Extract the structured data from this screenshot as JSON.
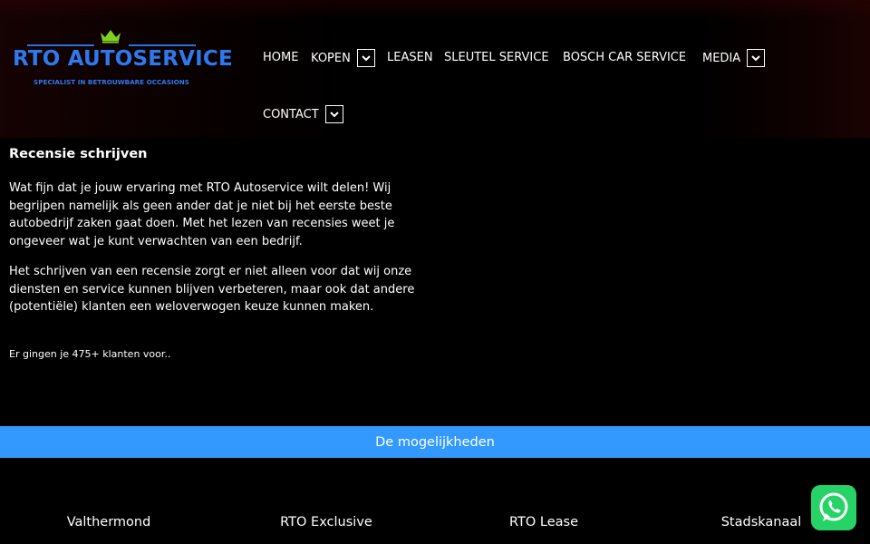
{
  "brand": {
    "name": "RTO AUTOSERVICE",
    "tagline": "SPECIALIST IN BETROUWBARE OCCASIONS",
    "color": "#2f78ee",
    "crown_color": "#7ed321",
    "icon": "crown-icon"
  },
  "nav": {
    "home": "HOME",
    "kopen": "KOPEN",
    "leasen": "LEASEN",
    "sleutel": "SLEUTEL SERVICE",
    "bosch": "BOSCH CAR SERVICE",
    "media": "MEDIA",
    "contact": "CONTACT",
    "dropdown_icon": "chevron-down-icon"
  },
  "content": {
    "heading": "Recensie schrijven",
    "paragraph1": "Wat fijn dat je jouw ervaring met RTO Autoservice wilt delen! Wij begrijpen namelijk als geen ander dat je niet bij het eerste beste autobedrijf zaken gaat doen. Met het lezen van recensies weet je ongeveer wat je kunt verwachten van een bedrijf.",
    "paragraph2": "Het schrijven van een recensie zorgt er niet alleen voor dat wij onze diensten en service kunnen blijven verbeteren, maar ook dat andere (potentiële) klanten een weloverwogen keuze kunnen maken.",
    "note": "Er gingen je 475+ klanten voor.."
  },
  "banner": {
    "label": "De mogelijkheden",
    "color": "#3399ff"
  },
  "locations": [
    "Valthermond",
    "RTO Exclusive",
    "RTO Lease",
    "Stadskanaal"
  ],
  "whatsapp": {
    "icon": "whatsapp-icon",
    "color": "#25d366"
  }
}
